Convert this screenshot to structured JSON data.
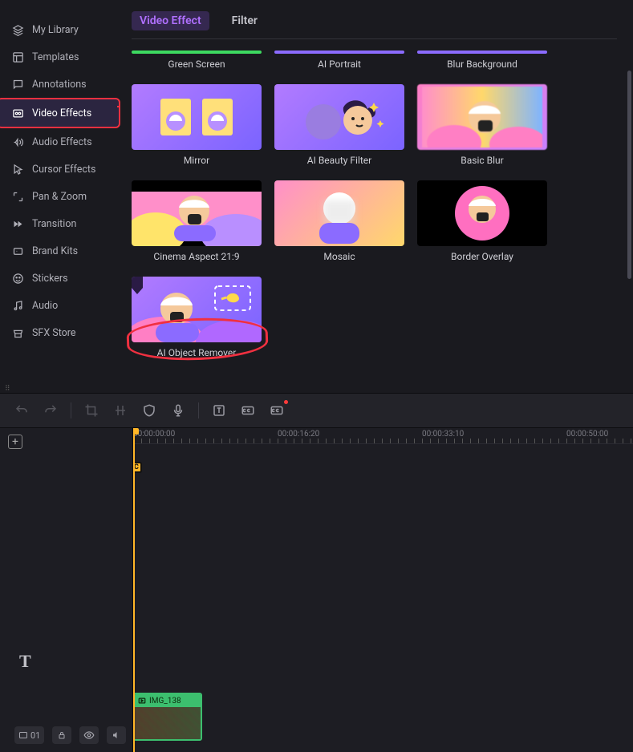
{
  "sidebar": {
    "items": [
      {
        "label": "My Library",
        "icon": "layers"
      },
      {
        "label": "Templates",
        "icon": "template"
      },
      {
        "label": "Annotations",
        "icon": "annotate"
      },
      {
        "label": "Video Effects",
        "icon": "video-fx",
        "active": true,
        "highlighted": true
      },
      {
        "label": "Audio Effects",
        "icon": "audio-fx"
      },
      {
        "label": "Cursor Effects",
        "icon": "cursor-fx"
      },
      {
        "label": "Pan & Zoom",
        "icon": "panzoom"
      },
      {
        "label": "Transition",
        "icon": "transition"
      },
      {
        "label": "Brand Kits",
        "icon": "brand"
      },
      {
        "label": "Stickers",
        "icon": "sticker"
      },
      {
        "label": "Audio",
        "icon": "music"
      },
      {
        "label": "SFX Store",
        "icon": "store"
      }
    ]
  },
  "tabs": {
    "items": [
      {
        "label": "Video Effect",
        "active": true
      },
      {
        "label": "Filter",
        "active": false
      }
    ]
  },
  "effects": {
    "row0": [
      {
        "label": "Green Screen",
        "barColor": "#3dd960"
      },
      {
        "label": "AI Portrait",
        "barColor": "#8b6bff"
      },
      {
        "label": "Blur Background",
        "barColor": "#8b6bff"
      }
    ],
    "row1": [
      {
        "label": "Mirror"
      },
      {
        "label": "AI Beauty Filter"
      },
      {
        "label": "Basic Blur"
      }
    ],
    "row2": [
      {
        "label": "Cinema Aspect 21:9"
      },
      {
        "label": "Mosaic"
      },
      {
        "label": "Border Overlay"
      }
    ],
    "row3": [
      {
        "label": "AI Object Remover",
        "highlighted": true
      }
    ]
  },
  "toolbar": {
    "undo": "undo",
    "redo": "redo",
    "crop": "crop",
    "split": "split",
    "shield": "shield",
    "mic": "mic",
    "text": "text-box",
    "cc": "cc",
    "cc2": "cc-live"
  },
  "timeline": {
    "ruler": [
      "00:00:00:00",
      "00:00:16:20",
      "00:00:33:10",
      "00:00:50:00"
    ],
    "marker": "C",
    "clip_name": "IMG_138",
    "track_count": "01",
    "text_icon": "T"
  }
}
